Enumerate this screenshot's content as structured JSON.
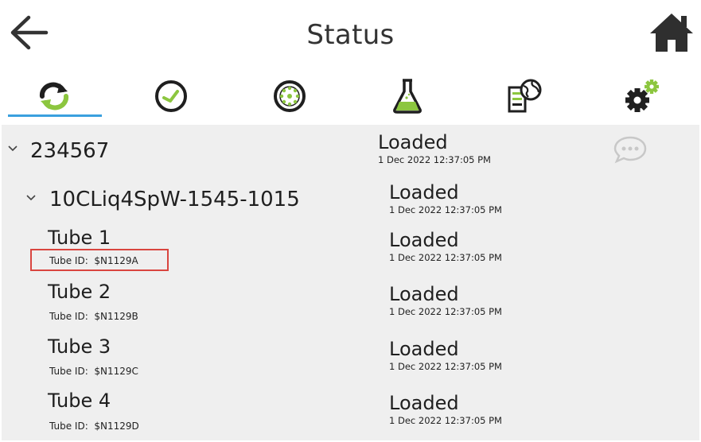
{
  "header": {
    "title": "Status"
  },
  "icons": {
    "back": "arrow-left-icon",
    "home": "home-icon",
    "comment": "comment-icon"
  },
  "tabs": [
    {
      "icon": "sync-status-icon",
      "active": true
    },
    {
      "icon": "clock-icon",
      "active": false
    },
    {
      "icon": "rack-icon",
      "active": false
    },
    {
      "icon": "flask-icon",
      "active": false
    },
    {
      "icon": "lims-icon",
      "active": false
    },
    {
      "icon": "settings-icon",
      "active": false
    }
  ],
  "colors": {
    "accent": "#3aa0de",
    "highlight": "#d9453f",
    "panel": "#efefef",
    "flask_liquid": "#8cc63f"
  },
  "tree": {
    "batch": {
      "id": "234567",
      "status": "Loaded",
      "timestamp": "1 Dec 2022 12:37:05 PM"
    },
    "method": {
      "name": "10CLiq4SpW-1545-1015",
      "status": "Loaded",
      "timestamp": "1 Dec 2022 12:37:05 PM"
    },
    "tubes": [
      {
        "name": "Tube 1",
        "id_label": "Tube ID:",
        "id": "$N1129A",
        "status": "Loaded",
        "timestamp": "1 Dec 2022 12:37:05 PM"
      },
      {
        "name": "Tube 2",
        "id_label": "Tube ID:",
        "id": "$N1129B",
        "status": "Loaded",
        "timestamp": "1 Dec 2022 12:37:05 PM"
      },
      {
        "name": "Tube 3",
        "id_label": "Tube ID:",
        "id": "$N1129C",
        "status": "Loaded",
        "timestamp": "1 Dec 2022 12:37:05 PM"
      },
      {
        "name": "Tube 4",
        "id_label": "Tube ID:",
        "id": "$N1129D",
        "status": "Loaded",
        "timestamp": "1 Dec 2022 12:37:05 PM"
      }
    ]
  }
}
